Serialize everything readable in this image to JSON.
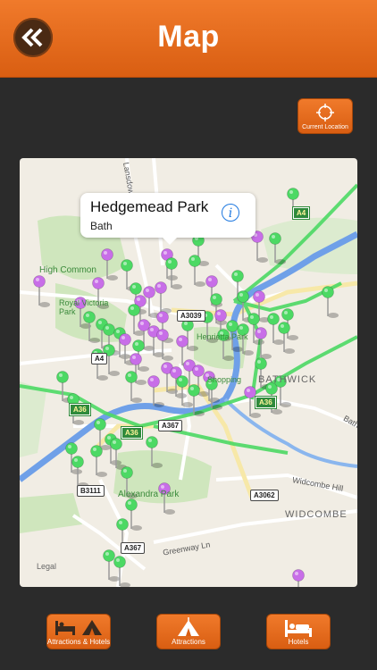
{
  "header": {
    "title": "Map"
  },
  "toolbar": {
    "current_location_label": "Current Location"
  },
  "callout": {
    "title": "Hedgemead Park",
    "subtitle": "Bath"
  },
  "map_labels": {
    "high_common": "High Common",
    "royal_victoria_park": "Royal Victoria Park",
    "henrietta_park": "Henrietta Park",
    "bathwick": "BATHWICK",
    "alexandra_park": "Alexandra Park",
    "widcombe_hill": "Widcombe Hill",
    "widcombe": "WIDCOMBE",
    "greenway_ln": "Greenway Ln",
    "bath_road": "Bath",
    "lansdown": "Lansdown",
    "shopping": "Shopping",
    "legal": "Legal"
  },
  "road_shields": {
    "a4": "A4",
    "a3039": "A3039",
    "a36_left": "A36",
    "a36_mid": "A36",
    "a36_right": "A36",
    "a367_a": "A367",
    "a367_b": "A367",
    "b3111": "B3111",
    "a3062": "A3062",
    "a4_small": "A4"
  },
  "footer": {
    "attractions_hotels": "Attractions & Hotels",
    "attractions": "Attractions",
    "hotels": "Hotels"
  },
  "colors": {
    "accent": "#e8691d",
    "pin_green": "#4cd964",
    "pin_purple": "#c86ee8",
    "route_green": "#4cd964",
    "river": "#6fa0e8"
  }
}
